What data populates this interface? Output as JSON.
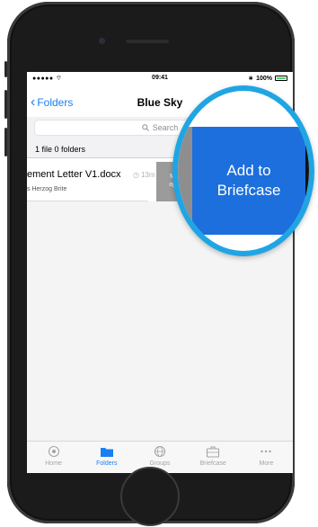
{
  "status": {
    "signal": "●●●●● ",
    "time": "09:41",
    "battery_text": "100%"
  },
  "nav": {
    "back_label": "Folders",
    "title": "Blue Sky"
  },
  "search": {
    "placeholder": "Search"
  },
  "summary": "1 file 0 folders",
  "file": {
    "name": "ement Letter V1.docx",
    "time": "13m",
    "owner": "s Herzog Brite",
    "more_label_line1": "Mo",
    "more_label_line2": "opti"
  },
  "tabs": [
    {
      "label": "Home",
      "icon": "home-icon",
      "active": false
    },
    {
      "label": "Folders",
      "icon": "folder-icon",
      "active": true
    },
    {
      "label": "Groups",
      "icon": "groups-icon",
      "active": false
    },
    {
      "label": "Briefcase",
      "icon": "briefcase-icon",
      "active": false
    },
    {
      "label": "More",
      "icon": "more-icon",
      "active": false
    }
  ],
  "magnifier": {
    "line1": "Add to",
    "line2": "Briefcase"
  },
  "colors": {
    "accent": "#1a7ff2",
    "action_blue": "#1c6fdc",
    "ring": "#1fa5e4",
    "more_gray": "#9b9b9b"
  }
}
